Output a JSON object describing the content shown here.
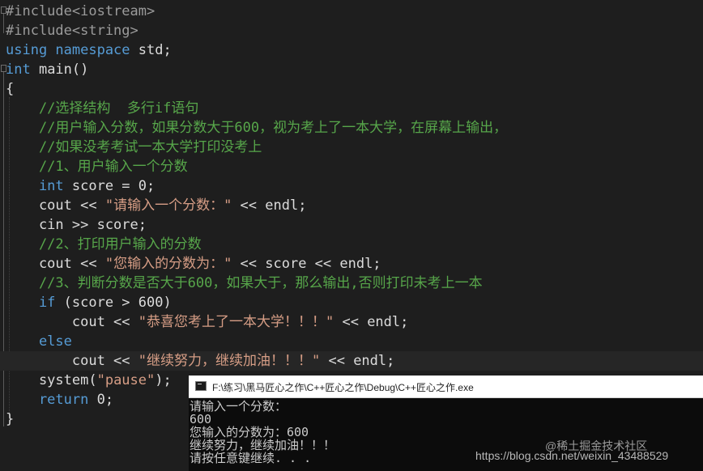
{
  "editor": {
    "lines": [
      [
        {
          "c": "pp",
          "t": "#include<iostream>"
        }
      ],
      [
        {
          "c": "pp",
          "t": "#include<string>"
        }
      ],
      [
        {
          "c": "kw",
          "t": "using namespace"
        },
        {
          "c": "id",
          "t": " std;"
        }
      ],
      [
        {
          "c": "kw",
          "t": "int"
        },
        {
          "c": "id",
          "t": " main()"
        }
      ],
      [
        {
          "c": "id",
          "t": "{"
        }
      ],
      [
        {
          "c": "cm",
          "t": "    //选择结构  多行if语句"
        }
      ],
      [
        {
          "c": "cm",
          "t": "    //用户输入分数，如果分数大于600，视为考上了一本大学，在屏幕上输出，"
        }
      ],
      [
        {
          "c": "cm",
          "t": "    //如果没考考试一本大学打印没考上"
        }
      ],
      [
        {
          "c": "cm",
          "t": "    //1、用户输入一个分数"
        }
      ],
      [
        {
          "c": "kw",
          "t": "    int"
        },
        {
          "c": "id",
          "t": " score = 0;"
        }
      ],
      [
        {
          "c": "id",
          "t": "    cout << "
        },
        {
          "c": "str",
          "t": "\"请输入一个分数：\""
        },
        {
          "c": "id",
          "t": " << endl;"
        }
      ],
      [
        {
          "c": "id",
          "t": "    cin >> score;"
        }
      ],
      [
        {
          "c": "cm",
          "t": "    //2、打印用户输入的分数"
        }
      ],
      [
        {
          "c": "id",
          "t": "    cout << "
        },
        {
          "c": "str",
          "t": "\"您输入的分数为：\""
        },
        {
          "c": "id",
          "t": " << score << endl;"
        }
      ],
      [
        {
          "c": "cm",
          "t": "    //3、判断分数是否大于600，如果大于，那么输出,否则打印未考上一本"
        }
      ],
      [
        {
          "c": "kw",
          "t": "    if"
        },
        {
          "c": "id",
          "t": " (score > 600)"
        }
      ],
      [
        {
          "c": "id",
          "t": "        cout << "
        },
        {
          "c": "str",
          "t": "\"恭喜您考上了一本大学！！！\""
        },
        {
          "c": "id",
          "t": " << endl;"
        }
      ],
      [
        {
          "c": "kw",
          "t": "    else"
        }
      ],
      [
        {
          "c": "id",
          "t": "        cout << "
        },
        {
          "c": "str",
          "t": "\"继续努力，继续加油！！！\""
        },
        {
          "c": "id",
          "t": " << endl;"
        }
      ],
      [
        {
          "c": "id",
          "t": "    system("
        },
        {
          "c": "str",
          "t": "\"pause\""
        },
        {
          "c": "id",
          "t": ");"
        }
      ],
      [
        {
          "c": "kw",
          "t": "    return"
        },
        {
          "c": "id",
          "t": " 0;"
        }
      ],
      [
        {
          "c": "id",
          "t": "}"
        }
      ]
    ],
    "current_line_index": 18
  },
  "console": {
    "title": "F:\\练习\\黑马匠心之作\\C++匠心之作\\Debug\\C++匠心之作.exe",
    "lines": [
      "请输入一个分数：",
      "600",
      "您输入的分数为：600",
      "继续努力，继续加油！！！",
      "请按任意键继续. . ."
    ]
  },
  "watermarks": {
    "site": "@稀土掘金技术社区",
    "csdn": "https://blog.csdn.net/weixin_43488529"
  }
}
